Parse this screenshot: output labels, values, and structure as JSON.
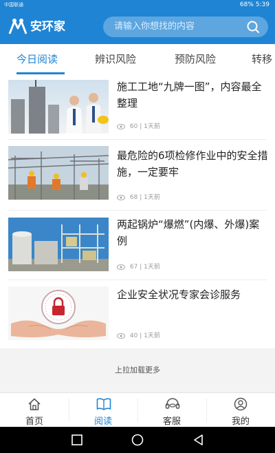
{
  "status": {
    "carrier": "中国联通",
    "battery": "68%",
    "time": "5:39"
  },
  "header": {
    "app_name": "安环家",
    "search_placeholder": "请输入你想找的内容"
  },
  "tabs": [
    {
      "label": "今日阅读",
      "active": true
    },
    {
      "label": "辨识风险",
      "active": false
    },
    {
      "label": "预防风险",
      "active": false
    },
    {
      "label": "转移",
      "active": false
    }
  ],
  "articles": [
    {
      "title": "施工工地“九牌一图”，内容最全整理",
      "views": "60",
      "time": "1天前",
      "thumb": "construction-engineers"
    },
    {
      "title": "最危险的6项检修作业中的安全措施，一定要牢",
      "views": "68",
      "time": "1天前",
      "thumb": "substation-workers"
    },
    {
      "title": "两起锅炉“爆燃”(内爆、外爆)案例",
      "views": "67",
      "time": "1天前",
      "thumb": "boiler-plant"
    },
    {
      "title": "企业安全状况专家会诊服务",
      "views": "40",
      "time": "1天前",
      "thumb": "hands-lock"
    }
  ],
  "load_more": "上拉加载更多",
  "bottom_nav": [
    {
      "label": "首页",
      "icon": "home-icon",
      "active": false
    },
    {
      "label": "阅读",
      "icon": "book-icon",
      "active": true
    },
    {
      "label": "客服",
      "icon": "headset-icon",
      "active": false
    },
    {
      "label": "我的",
      "icon": "user-icon",
      "active": false
    }
  ],
  "colors": {
    "brand": "#1f84d3",
    "text": "#222222",
    "meta": "#999999"
  }
}
